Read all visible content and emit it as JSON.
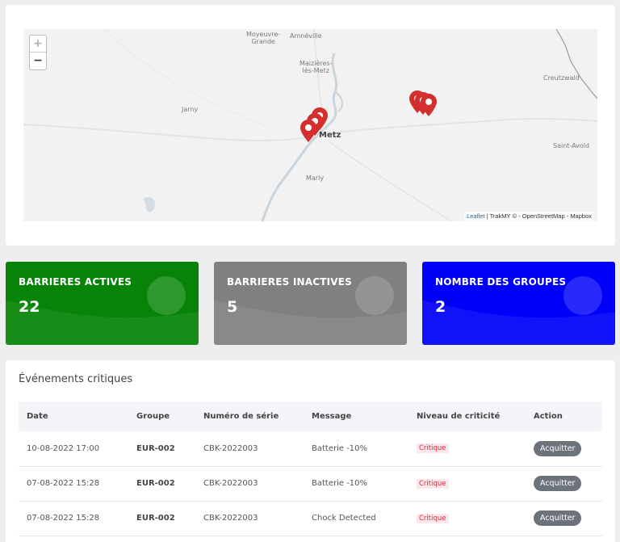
{
  "map": {
    "zoom_in": "+",
    "zoom_out": "−",
    "cities": {
      "moyeuvre": "Moyeuvre-\nGrande",
      "amneville": "Amnéville",
      "maizieres": "Maizières-\nlès-Metz",
      "creutzwald": "Creutzwald",
      "jarny": "Jarny",
      "metz": "Metz",
      "saint_avold": "Saint-Avold",
      "marly": "Marly"
    },
    "attribution": {
      "leaflet": "Leaflet",
      "rest": " | TrakMY © - OpenStreetMap - Mapbox"
    },
    "marker_color": "#d32f2f"
  },
  "stats": [
    {
      "title": "BARRIERES ACTIVES",
      "value": "22",
      "color": "#078407"
    },
    {
      "title": "BARRIERES INACTIVES",
      "value": "5",
      "color": "#808080"
    },
    {
      "title": "NOMBRE DES GROUPES",
      "value": "2",
      "color": "#0000fa"
    }
  ],
  "events": {
    "title": "Événements critiques",
    "columns": [
      "Date",
      "Groupe",
      "Numéro de série",
      "Message",
      "Niveau de criticité",
      "Action"
    ],
    "rows": [
      {
        "date": "10-08-2022 17:00",
        "group": "EUR-002",
        "serial": "CBK-2022003",
        "message": "Batterie -10%",
        "level": "Critique",
        "action": "Acquitter"
      },
      {
        "date": "07-08-2022 15:28",
        "group": "EUR-002",
        "serial": "CBK-2022003",
        "message": "Batterie -10%",
        "level": "Critique",
        "action": "Acquitter"
      },
      {
        "date": "07-08-2022 15:28",
        "group": "EUR-002",
        "serial": "CBK-2022003",
        "message": "Chock Detected",
        "level": "Critique",
        "action": "Acquitter"
      }
    ]
  }
}
